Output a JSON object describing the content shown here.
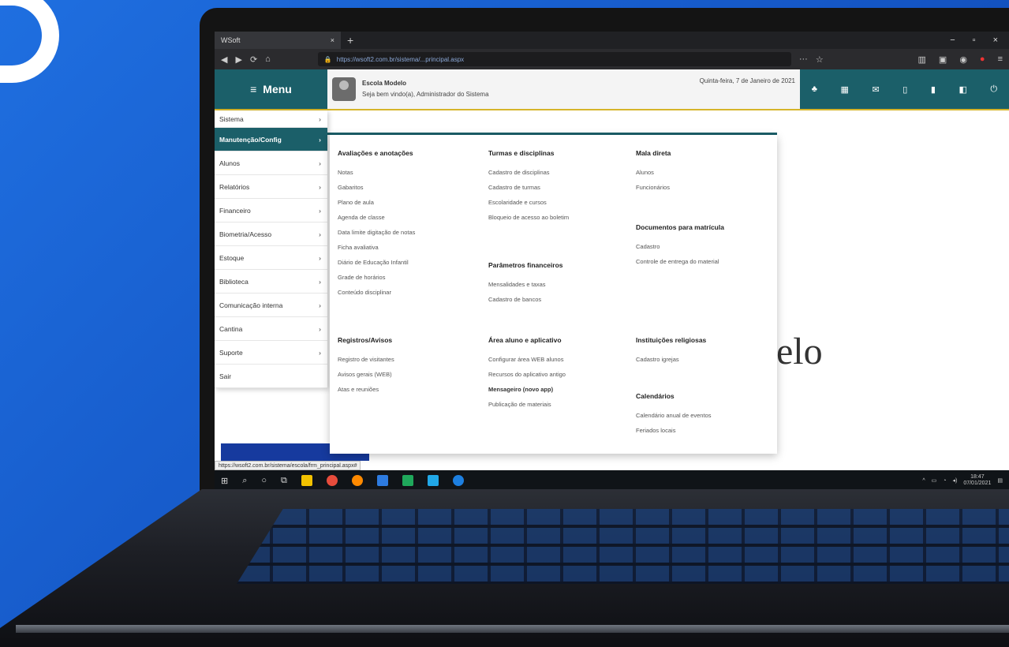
{
  "browser": {
    "tab_title": "WSoft",
    "tab_close": "×",
    "new_tab": "+",
    "window_controls": [
      "−",
      "▫",
      "×"
    ],
    "nav_icons": [
      "◀",
      "▶",
      "⟳",
      "⌂"
    ],
    "url": "https://wsoft2.com.br/sistema/...principal.aspx",
    "url_right_icons": [
      "···",
      "☆"
    ],
    "toolbar_right": [
      "▥",
      "▣",
      "◉",
      "●",
      "≡"
    ]
  },
  "app": {
    "menu_label": "Menu",
    "menu_icon": "≡",
    "school_name": "Escola Modelo",
    "welcome": "Seja bem vindo(a), Administrador do Sistema",
    "date": "Quinta-feira, 7 de Janeiro de 2021",
    "header_icons": [
      "♣",
      "▦",
      "✉",
      "▯",
      "▮",
      "◧",
      "⏻"
    ],
    "bg_word": "elo"
  },
  "sidebar": {
    "items": [
      {
        "label": "Sistema",
        "arrow": "›"
      },
      {
        "label": "Manutenção/Config",
        "arrow": "›"
      },
      {
        "label": "Alunos",
        "arrow": "›"
      },
      {
        "label": "Relatórios",
        "arrow": "›"
      },
      {
        "label": "Financeiro",
        "arrow": "›"
      },
      {
        "label": "Biometria/Acesso",
        "arrow": "›"
      },
      {
        "label": "Estoque",
        "arrow": "›"
      },
      {
        "label": "Biblioteca",
        "arrow": "›"
      },
      {
        "label": "Comunicação interna",
        "arrow": "›"
      },
      {
        "label": "Cantina",
        "arrow": "›"
      },
      {
        "label": "Suporte",
        "arrow": "›"
      },
      {
        "label": "Sair",
        "arrow": ""
      }
    ]
  },
  "mega_menu": {
    "col1_top": {
      "title": "Avaliações e anotações",
      "links": [
        "Notas",
        "Gabaritos",
        "Plano de aula",
        "Agenda de classe",
        "Data limite digitação de notas",
        "Ficha avaliativa",
        "Diário de Educação Infantil",
        "Grade de horários",
        "Conteúdo disciplinar"
      ]
    },
    "col1_bottom": {
      "title": "Registros/Avisos",
      "links": [
        "Registro de visitantes",
        "Avisos gerais (WEB)",
        "Atas e reuniões"
      ]
    },
    "col2_top": {
      "title": "Turmas e disciplinas",
      "links": [
        "Cadastro de disciplinas",
        "Cadastro de turmas",
        "Escolaridade e cursos",
        "Bloqueio de acesso ao boletim"
      ]
    },
    "col2_mid": {
      "title": "Parâmetros financeiros",
      "links": [
        "Mensalidades e taxas",
        "Cadastro de bancos"
      ]
    },
    "col2_bottom": {
      "title": "Área aluno e aplicativo",
      "links": [
        "Configurar área WEB alunos",
        "Recursos do aplicativo antigo",
        "Mensageiro (novo app)",
        "Publicação de materiais"
      ]
    },
    "col3_top": {
      "title": "Mala direta",
      "links": [
        "Alunos",
        "Funcionários"
      ]
    },
    "col3_mid": {
      "title": "Documentos para matrícula",
      "links": [
        "Cadastro",
        "Controle de entrega do material"
      ]
    },
    "col3_bottom": {
      "title": "Instituições religiosas",
      "links": [
        "Cadastro igrejas"
      ]
    },
    "col3_last": {
      "title": "Calendários",
      "links": [
        "Calendário anual de eventos",
        "Feriados locais"
      ]
    }
  },
  "status_url": "https://wsoft2.com.br/sistema/escola/frm_principal.aspx#",
  "taskbar": {
    "time": "18:47",
    "date": "07/01/2021",
    "colors": [
      "#f2c200",
      "#e74c3c",
      "#ff8a00",
      "#2d7be0",
      "#1fa85b",
      "#21a8e8",
      "#1d7fe0"
    ]
  },
  "colors": {
    "accent": "#1b5f69",
    "brand_blue": "#1f6fe0",
    "divider_gold": "#d6b42a"
  }
}
